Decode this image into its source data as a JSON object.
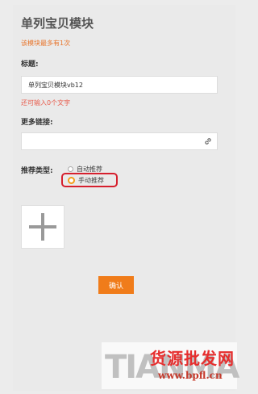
{
  "header": {
    "title": "单列宝贝模块",
    "subtitle": "该模块最多有1次"
  },
  "form": {
    "title_label": "标题:",
    "title_value": "单列宝贝模块vb12",
    "title_hint": "还可输入0个文字",
    "more_link_label": "更多链接:",
    "more_link_value": "",
    "recommend_type_label": "推荐类型:",
    "recommend_options": [
      {
        "label": "自动推荐",
        "selected": false
      },
      {
        "label": "手动推荐",
        "selected": true
      }
    ],
    "confirm_label": "确认"
  },
  "watermark": {
    "latin": "TIANMA",
    "chinese": "货源批发网",
    "url": "www.bpfl.cn"
  },
  "colors": {
    "accent": "#f07c1a",
    "hint": "#e85a4a",
    "highlight": "#d6202e"
  }
}
